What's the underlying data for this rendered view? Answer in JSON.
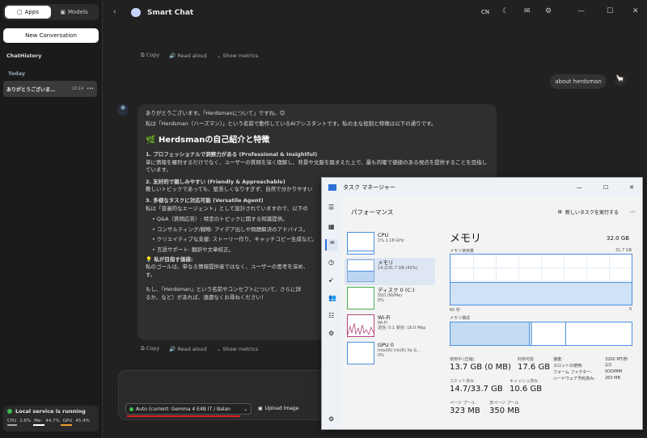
{
  "sidebar": {
    "tab_apps": "Apps",
    "tab_models": "Models",
    "new_conversation": "New Conversation",
    "history_title": "ChatHistory",
    "today": "Today",
    "item_title": "ありがとうございま…",
    "item_time": "10:14",
    "item_more": "•••",
    "status_text": "Local service is running",
    "status_cpu_label": "CPU",
    "status_cpu": "1.6%",
    "status_mem_label": "Me-",
    "status_mem": "44.7%",
    "status_gpu_label": "GPU",
    "status_gpu": "45.4%",
    "accent": "#3fb950"
  },
  "topbar": {
    "title": "Smart Chat",
    "lang": "CN"
  },
  "message_actions": {
    "copy": "Copy",
    "read_aloud": "Read aloud",
    "show_metrics": "Show metrics"
  },
  "user_message": "about herdsman",
  "assistant": {
    "line1": "ありがとうございます。「Herdsmanについて」ですね。😊",
    "line2": "私は「Herdsman（ハーズマン）」という名前で動作しているAIアシスタントです。私の主な役割と特徴は以下の通りです。",
    "heading": "Herdsmanの自己紹介と特徴",
    "p1_title": "1. プロフェッショナルで洞察力がある (Professional & Insightful)",
    "p1_body": "単に情報を羅列するだけでなく、ユーザーの質問を深く理解し、背景や文脈を踏まえた上で、最も的確で価値のある視点を提供することを目指しています。",
    "p2_title": "2. 友好的で親しみやすい (Friendly & Approachable)",
    "p2_body": "難しいトピックであっても、堅苦しくなりすぎず、自然で分かりやすい",
    "p3_title": "3. 多様なタスクに対応可能 (Versatile Agent)",
    "p3_body": "私は「普遍的なエージェント」として設計されていますので、以下の",
    "b1": "Q&A（質問応答）: 特定のトピックに関する知識提供。",
    "b2": "コンサルティング/戦略: アイデア出しや問題解決のアドバイス。",
    "b3": "クリエイティブな支援: ストーリー作り、キャッチコピー生成など。",
    "b4": "言語サポート: 翻訳や文章校正。",
    "goal_title": "💡 私が目指す価値:",
    "goal_body": "私のゴールは、単なる情報提供者ではなく、ユーザーの思考を深め、",
    "goal_body2": "す。",
    "closing": "もし、「Herdsman」という名前やコンセプトについて、さらに詳",
    "closing2": "るか、など）があれば、遠慮なくお尋ねください！"
  },
  "composer": {
    "model": "Auto (current: Gemma 4 E4B IT / Balan",
    "upload": "Upload Image"
  },
  "taskmanager": {
    "title": "タスク マネージャー",
    "section": "パフォーマンス",
    "run_task": "新しいタスクを実行する",
    "items": [
      {
        "name": "CPU",
        "sub1": "1%  1.18 GHz",
        "sub2": ""
      },
      {
        "name": "メモリ",
        "sub1": "14.2/31.7 GB (45%)",
        "sub2": ""
      },
      {
        "name": "ディスク 0 (C:)",
        "sub1": "SSD (NVMe)",
        "sub2": "0%"
      },
      {
        "name": "Wi-Fi",
        "sub1": "Wi-Fi",
        "sub2": "送信: 0.1  受信: 16.0 Mbp"
      },
      {
        "name": "GPU 0",
        "sub1": "Intel(R) Iris(R) Xe G…",
        "sub2": "0%"
      }
    ],
    "mem_title": "メモリ",
    "mem_total": "32.0 GB",
    "usage_label": "メモリ使用量",
    "usage_max": "31.7 GB",
    "axis_left": "60 秒",
    "axis_right": "0",
    "comp_label": "メモリ構成",
    "in_use_label": "使用中 (圧縮)",
    "in_use_value": "13.7 GB (0 MB)",
    "available_label": "利用可能",
    "available_value": "17.6 GB",
    "committed_label": "コミット済み",
    "committed_value": "14.7/33.7 GB",
    "cached_label": "キャッシュ済み",
    "cached_value": "10.6 GB",
    "paged_label": "ページ プール",
    "paged_value": "323 MB",
    "nonpaged_label": "非ページ プール",
    "nonpaged_value": "350 MB",
    "speed_label": "速度:",
    "speed_value": "3200 MT/秒",
    "slots_label": "スロットの使用:",
    "slots_value": "2/2",
    "form_label": "フォーム ファクター:",
    "form_value": "SODIMM",
    "reserved_label": "ハードウェア予約済み:",
    "reserved_value": "263 MB",
    "memory_usage_fraction": 0.45
  }
}
